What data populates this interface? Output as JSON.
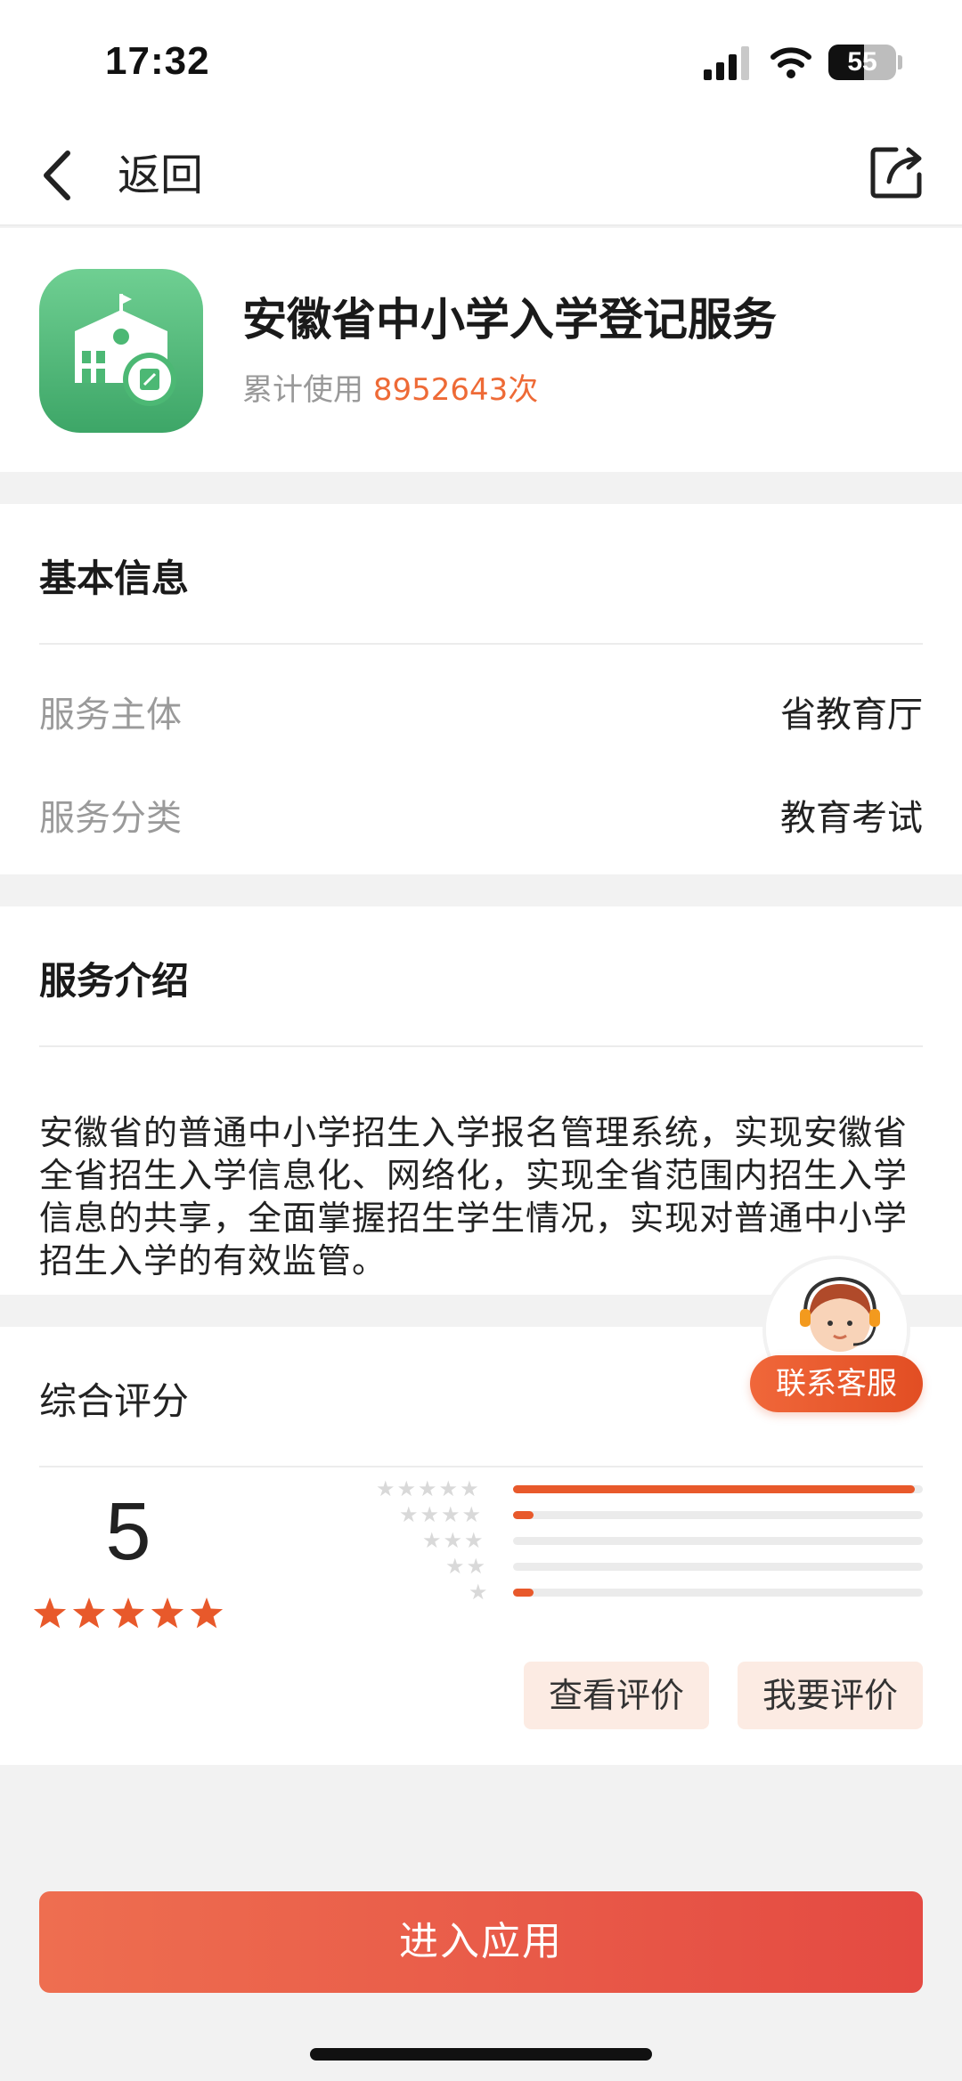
{
  "status_bar": {
    "time": "17:32",
    "battery": "55"
  },
  "nav": {
    "back_label": "返回"
  },
  "app": {
    "title": "安徽省中小学入学登记服务",
    "usage_prefix": "累计使用",
    "usage_count": "8952643次"
  },
  "basic_info": {
    "title": "基本信息",
    "rows": [
      {
        "label": "服务主体",
        "value": "省教育厅"
      },
      {
        "label": "服务分类",
        "value": "教育考试"
      }
    ]
  },
  "intro": {
    "title": "服务介绍",
    "text": "安徽省的普通中小学招生入学报名管理系统，实现安徽省全省招生入学信息化、网络化，实现全省范围内招生入学信息的共享，全面掌握招生学生情况，实现对普通中小学招生入学的有效监管。"
  },
  "rating": {
    "title": "综合评分",
    "score": "5",
    "stars": 5,
    "distribution": [
      {
        "stars": 5,
        "fraction": 0.98
      },
      {
        "stars": 4,
        "fraction": 0.05
      },
      {
        "stars": 3,
        "fraction": 0.0
      },
      {
        "stars": 2,
        "fraction": 0.0
      },
      {
        "stars": 1,
        "fraction": 0.05
      }
    ],
    "view_label": "查看评价",
    "write_label": "我要评价"
  },
  "customer_service": {
    "label": "联系客服"
  },
  "enter_button": {
    "label": "进入应用"
  },
  "colors": {
    "accent": "#e8592b",
    "usage": "#ee6a36",
    "logo_green": "#4cb874"
  }
}
